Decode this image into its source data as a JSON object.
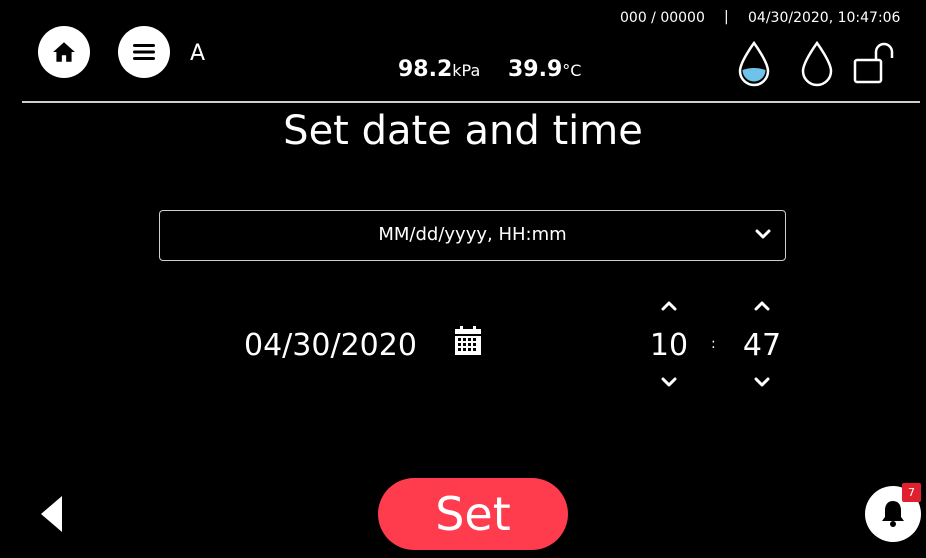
{
  "header": {
    "user_label": "A",
    "counter": "000 / 00000",
    "separator": "|",
    "datetime": "04/30/2020, 10:47:06",
    "pressure_value": "98.2",
    "pressure_unit": "kPa",
    "temperature_value": "39.9",
    "temperature_unit": "°C",
    "icons": [
      "home-icon",
      "menu-icon",
      "water-drop-filled-icon",
      "water-drop-outline-icon",
      "unlock-icon"
    ]
  },
  "page": {
    "title": "Set date and time"
  },
  "format": {
    "selected": "MM/dd/yyyy, HH:mm"
  },
  "date": {
    "value": "04/30/2020"
  },
  "time": {
    "hour": "10",
    "separator": ":",
    "minute": "47"
  },
  "footer": {
    "set_label": "Set",
    "notification_count": "7"
  },
  "colors": {
    "background": "#000000",
    "accent": "#ff3b4e",
    "badge": "#e0202f",
    "drop_fill": "#6fc3ea"
  }
}
